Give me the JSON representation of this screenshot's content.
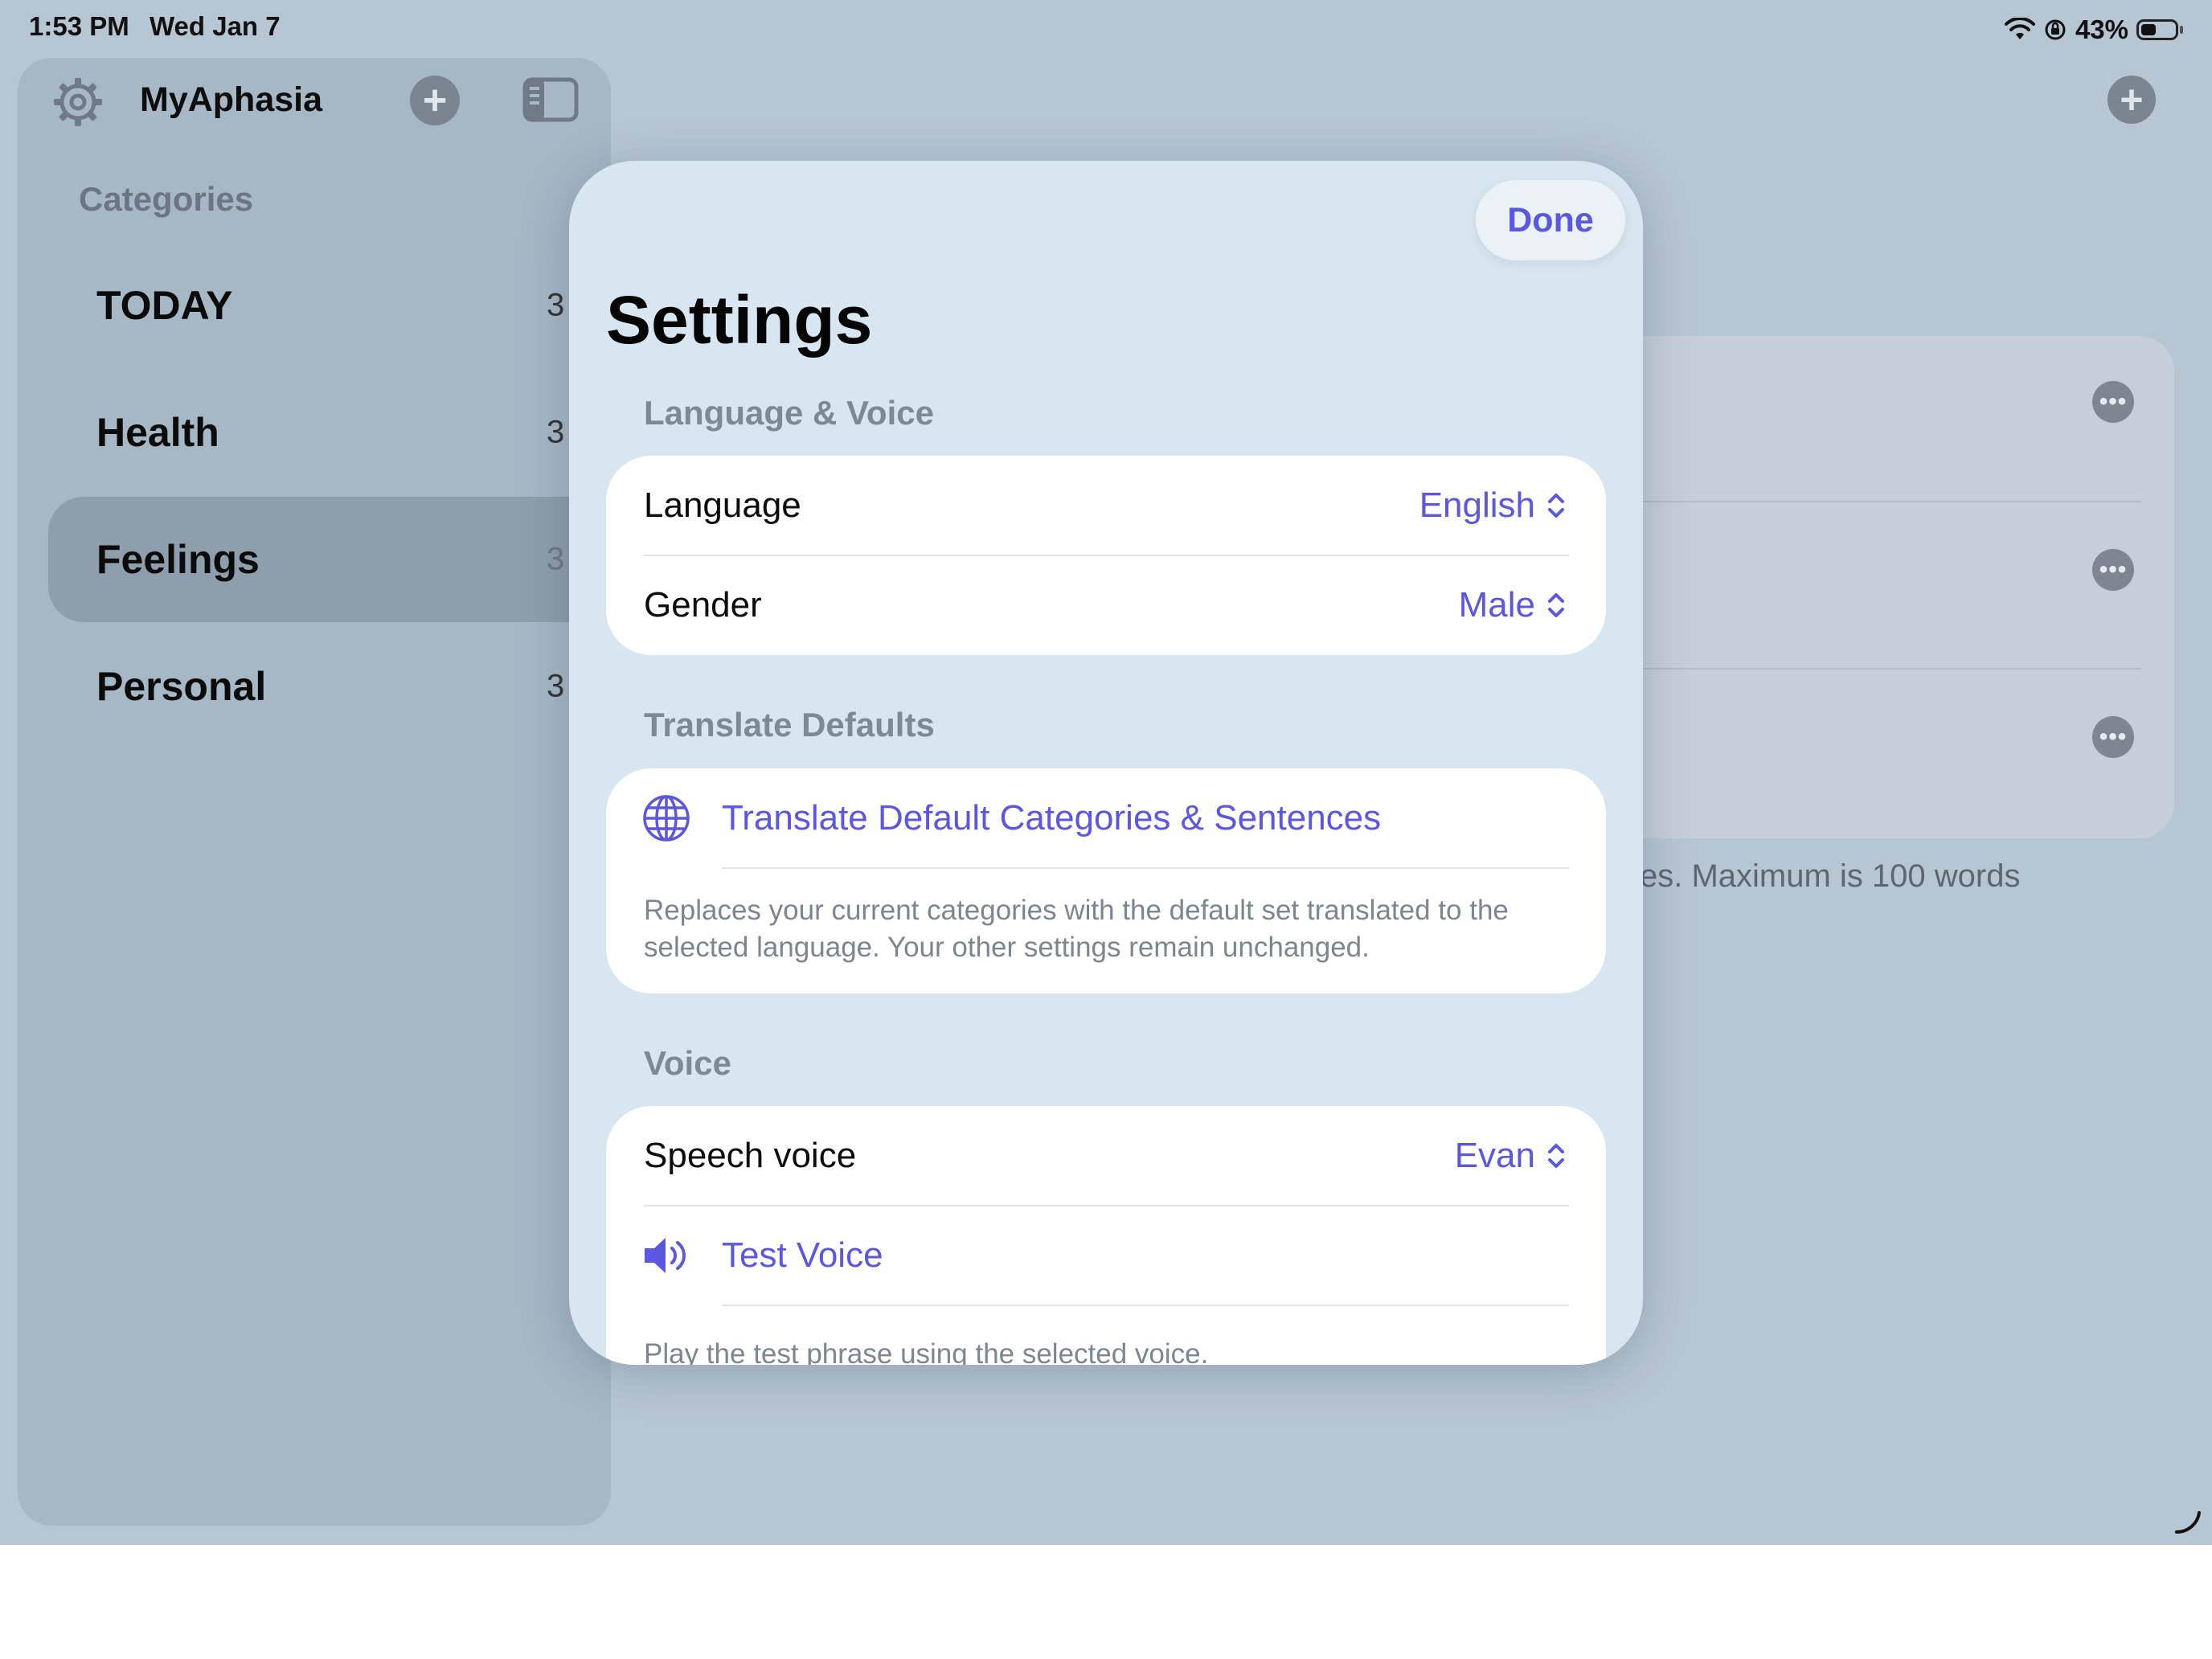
{
  "status_bar": {
    "time": "1:53 PM",
    "date": "Wed Jan 7",
    "battery_percent": "43%",
    "icons": [
      "wifi-icon",
      "orientation-lock-icon",
      "battery-icon"
    ]
  },
  "sidebar": {
    "app_title": "MyAphasia",
    "categories_label": "Categories",
    "items": [
      {
        "name": "TODAY",
        "count": "3",
        "selected": false
      },
      {
        "name": "Health",
        "count": "3",
        "selected": false
      },
      {
        "name": "Feelings",
        "count": "3",
        "selected": true
      },
      {
        "name": "Personal",
        "count": "3",
        "selected": false
      }
    ]
  },
  "background": {
    "footer_text": "es. Maximum is 100 words"
  },
  "settings": {
    "done_label": "Done",
    "title": "Settings",
    "language_voice": {
      "header": "Language & Voice",
      "language_label": "Language",
      "language_value": "English",
      "gender_label": "Gender",
      "gender_value": "Male"
    },
    "translate_defaults": {
      "header": "Translate Defaults",
      "action_label": "Translate Default Categories & Sentences",
      "footnote": "Replaces your current categories with the default set translated to the selected language. Your other settings remain unchanged."
    },
    "voice": {
      "header": "Voice",
      "speech_voice_label": "Speech voice",
      "speech_voice_value": "Evan",
      "test_voice_label": "Test Voice",
      "footnote": "Play the test phrase using the selected voice."
    }
  },
  "colors": {
    "accent": "#5b57e0",
    "backdrop": "#b7c6d3",
    "sheet": "#d8e6f1"
  }
}
